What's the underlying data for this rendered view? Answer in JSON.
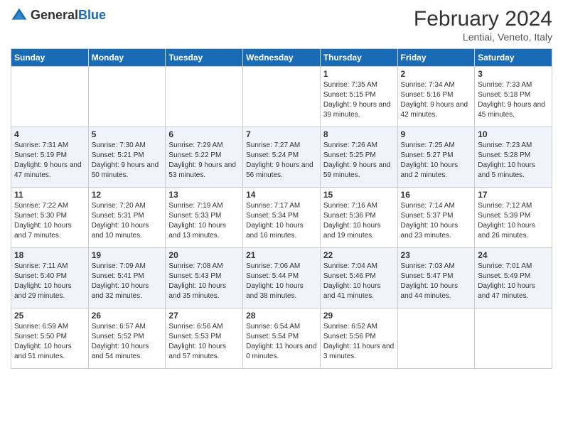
{
  "header": {
    "logo_general": "General",
    "logo_blue": "Blue",
    "month_title": "February 2024",
    "location": "Lentiai, Veneto, Italy"
  },
  "days_of_week": [
    "Sunday",
    "Monday",
    "Tuesday",
    "Wednesday",
    "Thursday",
    "Friday",
    "Saturday"
  ],
  "weeks": [
    [
      {
        "day": "",
        "info": ""
      },
      {
        "day": "",
        "info": ""
      },
      {
        "day": "",
        "info": ""
      },
      {
        "day": "",
        "info": ""
      },
      {
        "day": "1",
        "info": "Sunrise: 7:35 AM\nSunset: 5:15 PM\nDaylight: 9 hours\nand 39 minutes."
      },
      {
        "day": "2",
        "info": "Sunrise: 7:34 AM\nSunset: 5:16 PM\nDaylight: 9 hours\nand 42 minutes."
      },
      {
        "day": "3",
        "info": "Sunrise: 7:33 AM\nSunset: 5:18 PM\nDaylight: 9 hours\nand 45 minutes."
      }
    ],
    [
      {
        "day": "4",
        "info": "Sunrise: 7:31 AM\nSunset: 5:19 PM\nDaylight: 9 hours\nand 47 minutes."
      },
      {
        "day": "5",
        "info": "Sunrise: 7:30 AM\nSunset: 5:21 PM\nDaylight: 9 hours\nand 50 minutes."
      },
      {
        "day": "6",
        "info": "Sunrise: 7:29 AM\nSunset: 5:22 PM\nDaylight: 9 hours\nand 53 minutes."
      },
      {
        "day": "7",
        "info": "Sunrise: 7:27 AM\nSunset: 5:24 PM\nDaylight: 9 hours\nand 56 minutes."
      },
      {
        "day": "8",
        "info": "Sunrise: 7:26 AM\nSunset: 5:25 PM\nDaylight: 9 hours\nand 59 minutes."
      },
      {
        "day": "9",
        "info": "Sunrise: 7:25 AM\nSunset: 5:27 PM\nDaylight: 10 hours\nand 2 minutes."
      },
      {
        "day": "10",
        "info": "Sunrise: 7:23 AM\nSunset: 5:28 PM\nDaylight: 10 hours\nand 5 minutes."
      }
    ],
    [
      {
        "day": "11",
        "info": "Sunrise: 7:22 AM\nSunset: 5:30 PM\nDaylight: 10 hours\nand 7 minutes."
      },
      {
        "day": "12",
        "info": "Sunrise: 7:20 AM\nSunset: 5:31 PM\nDaylight: 10 hours\nand 10 minutes."
      },
      {
        "day": "13",
        "info": "Sunrise: 7:19 AM\nSunset: 5:33 PM\nDaylight: 10 hours\nand 13 minutes."
      },
      {
        "day": "14",
        "info": "Sunrise: 7:17 AM\nSunset: 5:34 PM\nDaylight: 10 hours\nand 16 minutes."
      },
      {
        "day": "15",
        "info": "Sunrise: 7:16 AM\nSunset: 5:36 PM\nDaylight: 10 hours\nand 19 minutes."
      },
      {
        "day": "16",
        "info": "Sunrise: 7:14 AM\nSunset: 5:37 PM\nDaylight: 10 hours\nand 23 minutes."
      },
      {
        "day": "17",
        "info": "Sunrise: 7:12 AM\nSunset: 5:39 PM\nDaylight: 10 hours\nand 26 minutes."
      }
    ],
    [
      {
        "day": "18",
        "info": "Sunrise: 7:11 AM\nSunset: 5:40 PM\nDaylight: 10 hours\nand 29 minutes."
      },
      {
        "day": "19",
        "info": "Sunrise: 7:09 AM\nSunset: 5:41 PM\nDaylight: 10 hours\nand 32 minutes."
      },
      {
        "day": "20",
        "info": "Sunrise: 7:08 AM\nSunset: 5:43 PM\nDaylight: 10 hours\nand 35 minutes."
      },
      {
        "day": "21",
        "info": "Sunrise: 7:06 AM\nSunset: 5:44 PM\nDaylight: 10 hours\nand 38 minutes."
      },
      {
        "day": "22",
        "info": "Sunrise: 7:04 AM\nSunset: 5:46 PM\nDaylight: 10 hours\nand 41 minutes."
      },
      {
        "day": "23",
        "info": "Sunrise: 7:03 AM\nSunset: 5:47 PM\nDaylight: 10 hours\nand 44 minutes."
      },
      {
        "day": "24",
        "info": "Sunrise: 7:01 AM\nSunset: 5:49 PM\nDaylight: 10 hours\nand 47 minutes."
      }
    ],
    [
      {
        "day": "25",
        "info": "Sunrise: 6:59 AM\nSunset: 5:50 PM\nDaylight: 10 hours\nand 51 minutes."
      },
      {
        "day": "26",
        "info": "Sunrise: 6:57 AM\nSunset: 5:52 PM\nDaylight: 10 hours\nand 54 minutes."
      },
      {
        "day": "27",
        "info": "Sunrise: 6:56 AM\nSunset: 5:53 PM\nDaylight: 10 hours\nand 57 minutes."
      },
      {
        "day": "28",
        "info": "Sunrise: 6:54 AM\nSunset: 5:54 PM\nDaylight: 11 hours\nand 0 minutes."
      },
      {
        "day": "29",
        "info": "Sunrise: 6:52 AM\nSunset: 5:56 PM\nDaylight: 11 hours\nand 3 minutes."
      },
      {
        "day": "",
        "info": ""
      },
      {
        "day": "",
        "info": ""
      }
    ]
  ]
}
